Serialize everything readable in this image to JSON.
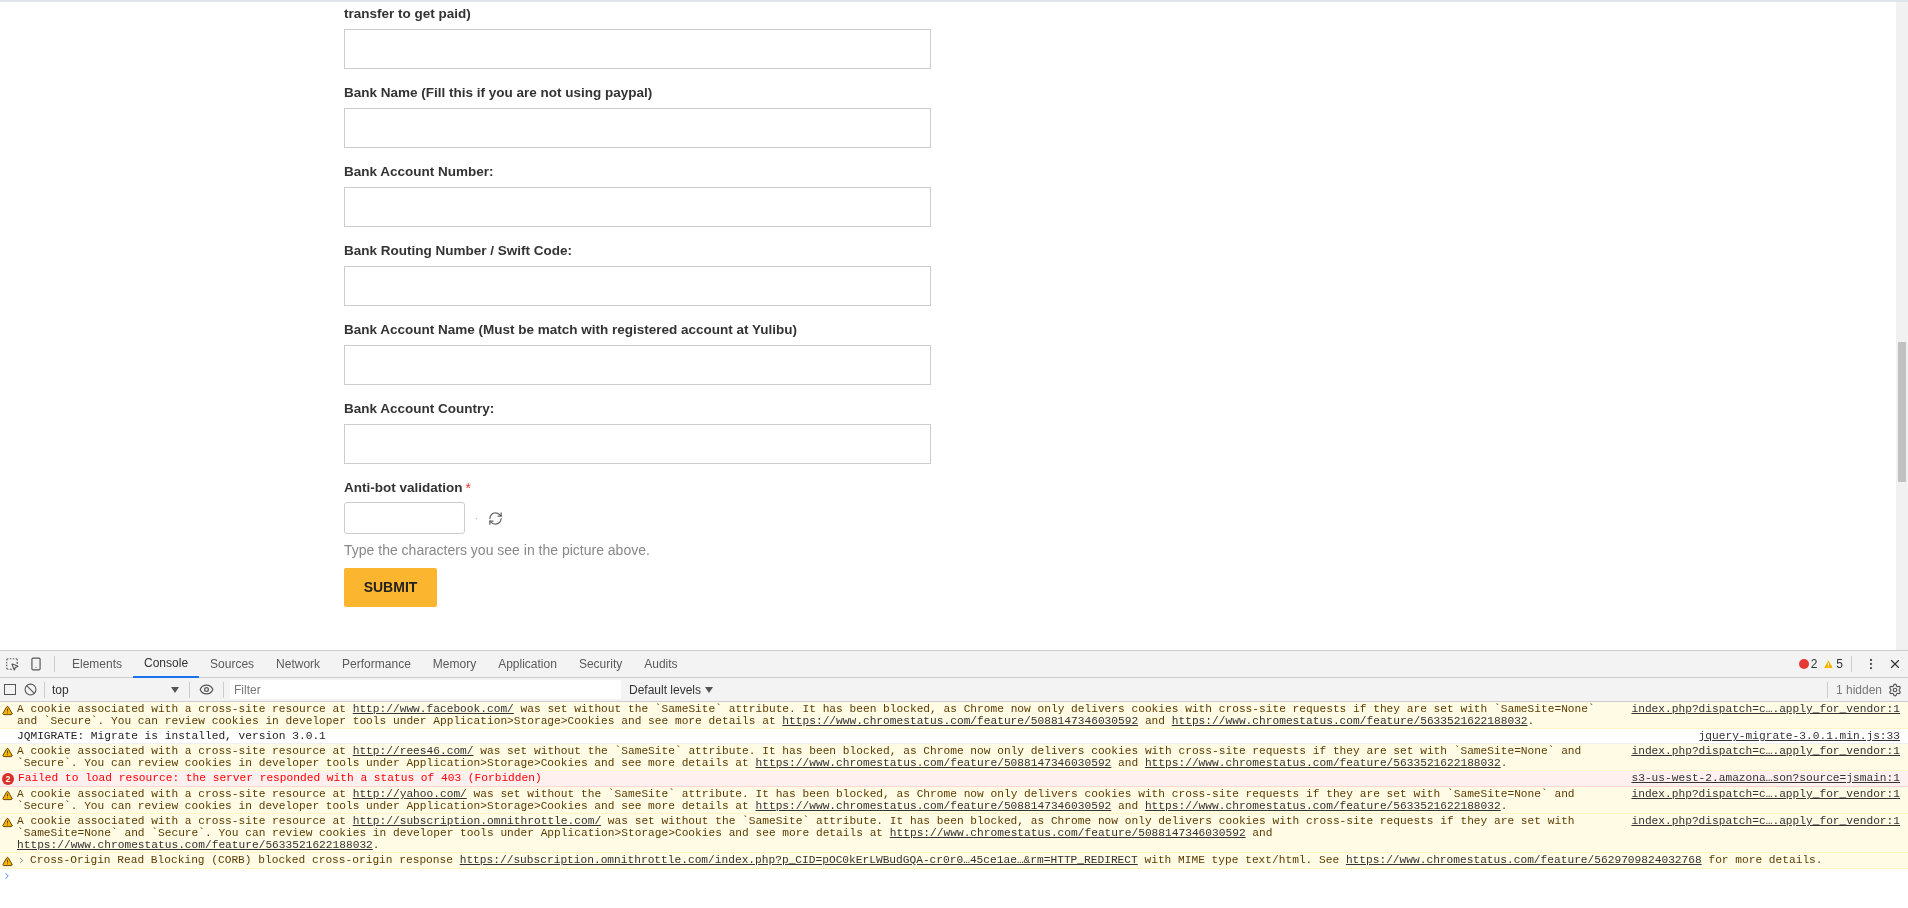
{
  "form": {
    "fields": [
      {
        "label": "transfer to get paid)"
      },
      {
        "label": "Bank Name (Fill this if you are not using paypal)"
      },
      {
        "label": "Bank Account Number:"
      },
      {
        "label": "Bank Routing Number / Swift Code:"
      },
      {
        "label": "Bank Account Name (Must be match with registered account at Yulibu)"
      },
      {
        "label": "Bank Account Country:"
      }
    ],
    "captcha": {
      "label": "Anti-bot validation",
      "required_mark": "*",
      "separator": "·",
      "hint": "Type the characters you see in the picture above."
    },
    "submit": "SUBMIT"
  },
  "devtools": {
    "tabs": [
      {
        "label": "Elements",
        "selected": false
      },
      {
        "label": "Console",
        "selected": true
      },
      {
        "label": "Sources",
        "selected": false
      },
      {
        "label": "Network",
        "selected": false
      },
      {
        "label": "Performance",
        "selected": false
      },
      {
        "label": "Memory",
        "selected": false
      },
      {
        "label": "Application",
        "selected": false
      },
      {
        "label": "Security",
        "selected": false
      },
      {
        "label": "Audits",
        "selected": false
      }
    ],
    "error_count": "2",
    "warning_count": "5",
    "toolbar": {
      "context": "top",
      "filter_placeholder": "Filter",
      "levels": "Default levels",
      "hidden": "1 hidden"
    },
    "messages": [
      {
        "kind": "warning",
        "segments": [
          {
            "kind": "text",
            "text": "A cookie associated with a cross-site resource at "
          },
          {
            "kind": "link",
            "text": "http://www.facebook.com/"
          },
          {
            "kind": "text",
            "text": " was set without the `SameSite` attribute. It has been blocked, as Chrome now only delivers cookies with cross-site requests if they are set with `SameSite=None` and `Secure`. You can review cookies in developer tools under Application>Storage>Cookies and see more details at "
          },
          {
            "kind": "link",
            "text": "https://www.chromestatus.com/feature/5088147346030592"
          },
          {
            "kind": "text",
            "text": " and "
          },
          {
            "kind": "link",
            "text": "https://www.chromestatus.com/feature/5633521622188032"
          },
          {
            "kind": "text",
            "text": "."
          }
        ],
        "source": "index.php?dispatch=c….apply_for_vendor:1"
      },
      {
        "kind": "info",
        "segments": [
          {
            "kind": "text",
            "text": "JQMIGRATE: Migrate is installed, version 3.0.1"
          }
        ],
        "source": "jquery-migrate-3.0.1.min.js:33"
      },
      {
        "kind": "warning",
        "segments": [
          {
            "kind": "text",
            "text": "A cookie associated with a cross-site resource at "
          },
          {
            "kind": "link",
            "text": "http://rees46.com/"
          },
          {
            "kind": "text",
            "text": " was set without the `SameSite` attribute. It has been blocked, as Chrome now only delivers cookies with cross-site requests if they are set with `SameSite=None` and `Secure`. You can review cookies in developer tools under Application>Storage>Cookies and see more details at "
          },
          {
            "kind": "link",
            "text": "https://www.chromestatus.com/feature/5088147346030592"
          },
          {
            "kind": "text",
            "text": " and "
          },
          {
            "kind": "link",
            "text": "https://www.chromestatus.com/feature/5633521622188032"
          },
          {
            "kind": "text",
            "text": "."
          }
        ],
        "source": "index.php?dispatch=c….apply_for_vendor:1"
      },
      {
        "kind": "error",
        "count": "2",
        "segments": [
          {
            "kind": "text",
            "text": "Failed to load resource: the server responded with a status of 403 (Forbidden)"
          }
        ],
        "source": "s3-us-west-2.amazona…son?source=jsmain:1"
      },
      {
        "kind": "warning",
        "segments": [
          {
            "kind": "text",
            "text": "A cookie associated with a cross-site resource at "
          },
          {
            "kind": "link",
            "text": "http://yahoo.com/"
          },
          {
            "kind": "text",
            "text": " was set without the `SameSite` attribute. It has been blocked, as Chrome now only delivers cookies with cross-site requests if they are set with `SameSite=None` and `Secure`. You can review cookies in developer tools under Application>Storage>Cookies and see more details at "
          },
          {
            "kind": "link",
            "text": "https://www.chromestatus.com/feature/5088147346030592"
          },
          {
            "kind": "text",
            "text": " and "
          },
          {
            "kind": "link",
            "text": "https://www.chromestatus.com/feature/5633521622188032"
          },
          {
            "kind": "text",
            "text": "."
          }
        ],
        "source": "index.php?dispatch=c….apply_for_vendor:1"
      },
      {
        "kind": "warning",
        "segments": [
          {
            "kind": "text",
            "text": "A cookie associated with a cross-site resource at "
          },
          {
            "kind": "link",
            "text": "http://subscription.omnithrottle.com/"
          },
          {
            "kind": "text",
            "text": " was set without the `SameSite` attribute. It has been blocked, as Chrome now only delivers cookies with cross-site requests if they are set with `SameSite=None` and `Secure`. You can review cookies in developer tools under Application>Storage>Cookies and see more details at "
          },
          {
            "kind": "link",
            "text": "https://www.chromestatus.com/feature/5088147346030592"
          },
          {
            "kind": "text",
            "text": " and "
          },
          {
            "kind": "link",
            "text": "https://www.chromestatus.com/feature/5633521622188032"
          },
          {
            "kind": "text",
            "text": "."
          }
        ],
        "source": "index.php?dispatch=c….apply_for_vendor:1"
      },
      {
        "kind": "warning",
        "expanded": false,
        "segments": [
          {
            "kind": "text",
            "text": "Cross-Origin Read Blocking (CORB) blocked cross-origin response "
          },
          {
            "kind": "link",
            "text": "https://subscription.omnithrottle.com/index.php?p_CID=pOC0kErLWBudGQA-cr0r0…45ce1ae…&rm=HTTP_REDIRECT"
          },
          {
            "kind": "text",
            "text": " with MIME type text/html. See "
          },
          {
            "kind": "link",
            "text": "https://www.chromestatus.com/feature/5629709824032768"
          },
          {
            "kind": "text",
            "text": " for more details."
          }
        ]
      }
    ]
  }
}
